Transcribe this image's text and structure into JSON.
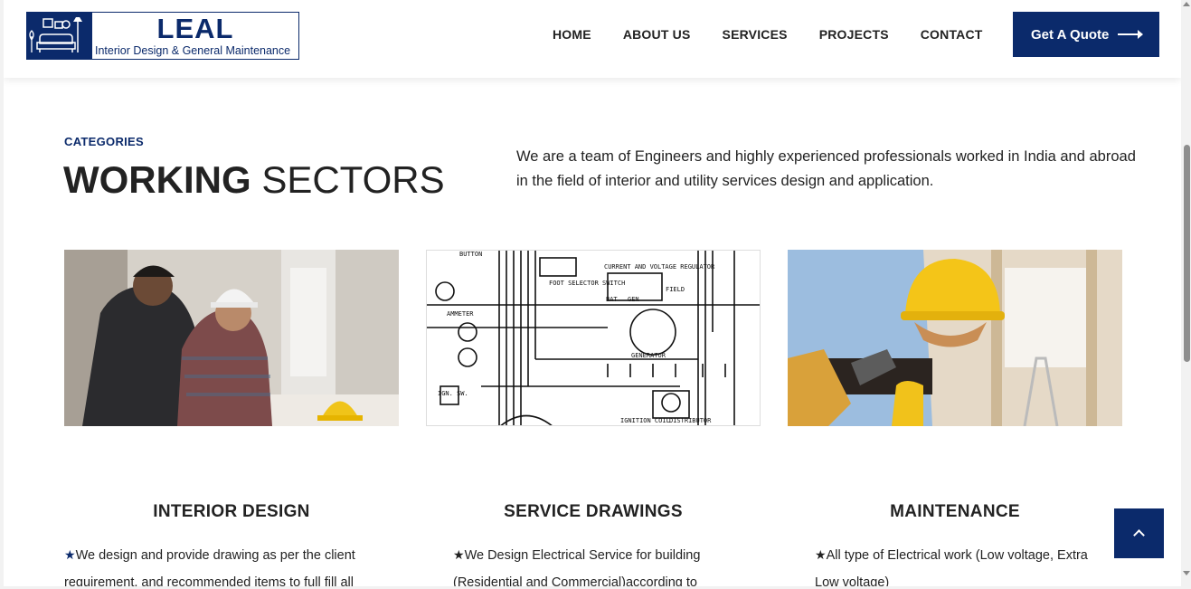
{
  "header": {
    "logo": {
      "title": "LEAL",
      "subtitle": "Interior Design & General Maintenance"
    },
    "nav": [
      "HOME",
      "ABOUT US",
      "SERVICES",
      "PROJECTS",
      "CONTACT"
    ],
    "cta_label": "Get A Quote"
  },
  "section": {
    "eyebrow": "CATEGORIES",
    "heading_bold": "WORKING",
    "heading_light": "SECTORS",
    "intro": "We are a team of Engineers and highly experienced professionals worked in India and abroad in the field of interior and utility services design and application."
  },
  "cards": [
    {
      "title": "INTERIOR DESIGN",
      "text": "We design and provide drawing as per the client requirement, and recommended items to full fill all"
    },
    {
      "title": "SERVICE DRAWINGS",
      "text": "We Design Electrical Service for building (Residential and Commercial)according to"
    },
    {
      "title": "MAINTENANCE",
      "text": "All type of Electrical work (Low voltage, Extra Low voltage)"
    }
  ],
  "diagram_labels": [
    "BUTTON",
    "AMMETER",
    "FOOT SELECTOR SWITCH",
    "CURRENT AND VOLTAGE REGULATOR",
    "BAT",
    "GEN",
    "FIELD",
    "GENERATOR",
    "IGN. SW.",
    "IGNITION COIL",
    "DISTRIBUTOR"
  ],
  "colors": {
    "brand": "#0b2a6b",
    "text": "#222222"
  },
  "icons": {
    "back_to_top": "chevron-up-icon",
    "star_first": "blue",
    "star_rest": "black"
  }
}
